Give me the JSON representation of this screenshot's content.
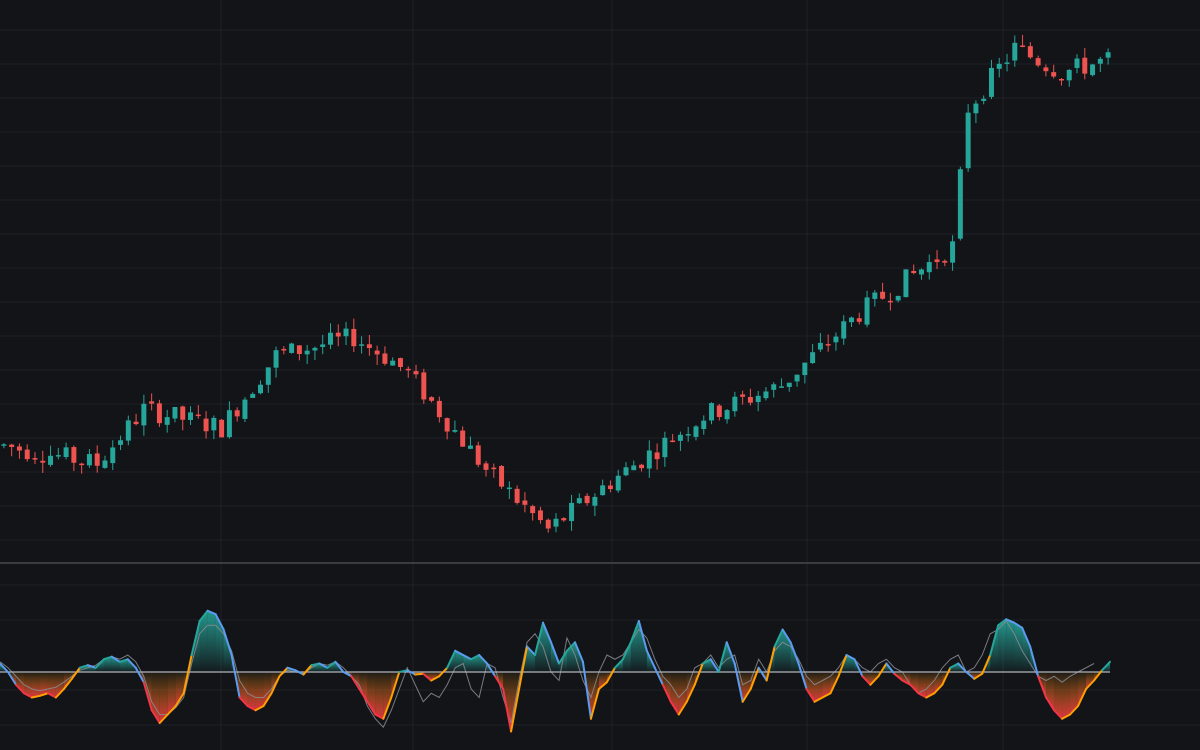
{
  "theme": {
    "background": "#131418",
    "grid_color": "#1f2128",
    "separator_color": "#3a3c44",
    "up_color": "#26a69a",
    "down_color": "#ef5350",
    "osc_up_color": "#26a69a",
    "osc_up_alt_color": "#5b9cf0",
    "osc_down_color": "#f23645",
    "osc_down_alt_color": "#ffa000",
    "signal_color": "#8a8c94",
    "zero_line_color": "#b0b3ba"
  },
  "chart_data": [
    {
      "type": "candlestick",
      "title": "",
      "xlabel": "",
      "ylabel": "",
      "grid": true,
      "ylim": [
        0,
        100
      ],
      "generator": {
        "bars": 143,
        "anchors": [
          [
            0,
            40
          ],
          [
            12,
            37
          ],
          [
            18,
            46
          ],
          [
            28,
            43
          ],
          [
            35,
            55
          ],
          [
            45,
            58
          ],
          [
            50,
            54
          ],
          [
            52,
            52
          ],
          [
            62,
            36
          ],
          [
            70,
            26
          ],
          [
            78,
            34
          ],
          [
            90,
            45
          ],
          [
            100,
            50
          ],
          [
            110,
            62
          ],
          [
            122,
            73
          ],
          [
            124,
            96
          ],
          [
            130,
            106
          ],
          [
            136,
            102
          ],
          [
            142,
            104
          ]
        ],
        "seed": 7,
        "volatility": 1.6
      }
    },
    {
      "type": "area",
      "title": "",
      "xlabel": "",
      "ylabel": "",
      "grid": true,
      "ylim": [
        -1,
        1
      ],
      "series": [
        {
          "role": "oscillator",
          "values": [
            0.1,
            0.0,
            -0.15,
            -0.25,
            -0.3,
            -0.28,
            -0.25,
            -0.3,
            -0.2,
            -0.08,
            0.05,
            0.08,
            0.05,
            0.15,
            0.18,
            0.12,
            0.15,
            0.05,
            -0.12,
            -0.45,
            -0.6,
            -0.5,
            -0.4,
            -0.25,
            0.2,
            0.6,
            0.72,
            0.68,
            0.5,
            0.2,
            -0.3,
            -0.4,
            -0.45,
            -0.4,
            -0.25,
            -0.05,
            0.05,
            0.02,
            -0.03,
            0.08,
            0.1,
            0.05,
            0.12,
            0.0,
            -0.05,
            -0.2,
            -0.35,
            -0.5,
            -0.55,
            -0.3,
            0.0,
            0.02,
            -0.03,
            -0.02,
            -0.1,
            -0.05,
            0.05,
            0.25,
            0.2,
            0.15,
            0.2,
            0.1,
            -0.05,
            -0.2,
            -0.7,
            -0.2,
            0.3,
            0.2,
            0.58,
            0.35,
            0.1,
            0.25,
            0.35,
            0.12,
            -0.55,
            -0.2,
            -0.12,
            0.05,
            0.15,
            0.35,
            0.6,
            0.25,
            0.05,
            -0.15,
            -0.35,
            -0.5,
            -0.35,
            -0.15,
            0.1,
            0.15,
            0.0,
            0.35,
            0.1,
            -0.35,
            -0.2,
            0.05,
            -0.1,
            0.3,
            0.5,
            0.35,
            0.1,
            -0.2,
            -0.35,
            -0.3,
            -0.25,
            -0.05,
            0.2,
            0.15,
            -0.05,
            -0.15,
            -0.05,
            0.1,
            -0.02,
            -0.1,
            -0.15,
            -0.25,
            -0.3,
            -0.25,
            -0.15,
            0.05,
            0.1,
            0.0,
            -0.08,
            -0.02,
            0.2,
            0.55,
            0.62,
            0.58,
            0.52,
            0.3,
            -0.05,
            -0.3,
            -0.45,
            -0.55,
            -0.5,
            -0.4,
            -0.2,
            -0.1,
            0.02,
            0.12
          ]
        },
        {
          "role": "signal",
          "values": [
            0.12,
            0.05,
            -0.05,
            -0.15,
            -0.2,
            -0.22,
            -0.2,
            -0.18,
            -0.12,
            -0.05,
            0.02,
            0.05,
            0.08,
            0.15,
            0.18,
            0.15,
            0.2,
            0.12,
            -0.05,
            -0.35,
            -0.5,
            -0.5,
            -0.42,
            -0.3,
            0.1,
            0.45,
            0.55,
            0.55,
            0.45,
            0.25,
            -0.1,
            -0.25,
            -0.3,
            -0.3,
            -0.2,
            -0.05,
            0.02,
            0.0,
            -0.02,
            0.05,
            0.1,
            0.08,
            0.12,
            0.05,
            -0.05,
            -0.15,
            -0.4,
            -0.55,
            -0.65,
            -0.45,
            -0.2,
            0.05,
            -0.15,
            -0.35,
            -0.25,
            -0.3,
            -0.15,
            0.05,
            0.1,
            -0.2,
            -0.3,
            0.1,
            0.05,
            -0.3,
            -0.6,
            -0.1,
            0.35,
            0.45,
            0.3,
            0.0,
            -0.1,
            0.4,
            0.2,
            -0.1,
            -0.3,
            0.0,
            0.2,
            0.15,
            0.2,
            0.35,
            0.5,
            0.4,
            0.15,
            -0.05,
            -0.15,
            -0.3,
            -0.2,
            0.05,
            0.1,
            0.2,
            0.05,
            0.15,
            0.2,
            -0.15,
            -0.1,
            0.15,
            0.0,
            0.25,
            0.35,
            0.3,
            0.15,
            -0.05,
            -0.15,
            -0.1,
            -0.05,
            0.05,
            0.2,
            0.15,
            0.05,
            0.0,
            0.1,
            0.15,
            0.05,
            0.0,
            -0.15,
            -0.25,
            -0.2,
            -0.1,
            0.05,
            0.15,
            0.2,
            0.0,
            0.05,
            0.2,
            0.45,
            0.5,
            0.6,
            0.45,
            0.25,
            0.1,
            -0.05,
            -0.1,
            -0.05,
            -0.12,
            -0.05,
            0.0,
            0.05,
            0.1
          ]
        }
      ]
    }
  ]
}
